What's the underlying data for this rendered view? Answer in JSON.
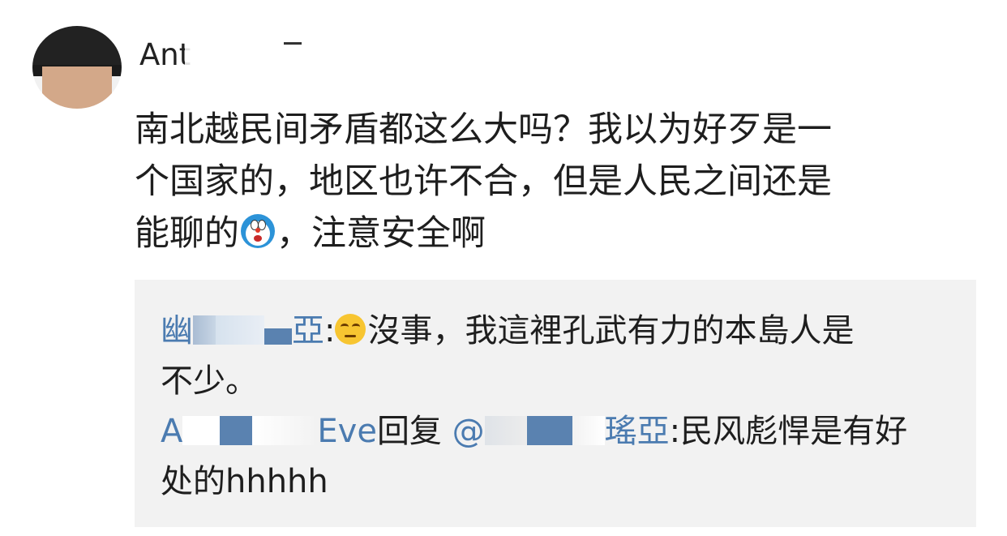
{
  "author": {
    "name_visible": "Ant",
    "avatar_icon": "user-avatar"
  },
  "comment": {
    "line1": "南北越民间矛盾都这么大吗？我以为好歹是一",
    "line2": "个国家的，地区也许不合，但是人民之间还是",
    "line3_before_emoji": "能聊的",
    "emoji": "doraemon-emoji",
    "line3_after_emoji": "，注意安全啊"
  },
  "replies": [
    {
      "user_prefix": "幽",
      "user_suffix": "亞",
      "separator": ":",
      "emoji": "thinking-face-emoji",
      "text_line1": "沒事，我這裡孔武有力的本島人是",
      "text_line2": "不少。"
    },
    {
      "user_prefix": "A",
      "user_suffix": "Eve",
      "reply_word": "回复",
      "mention_prefix": "@",
      "mention_suffix": "瑤亞",
      "separator": ":",
      "text_line1": "民风彪悍是有好",
      "text_line2": "处的hhhhh"
    }
  ],
  "colors": {
    "username_link": "#4b7bb0",
    "reply_background": "#f2f2f2",
    "text": "#1e1e1e",
    "mask_blue": "#5a82b0"
  }
}
